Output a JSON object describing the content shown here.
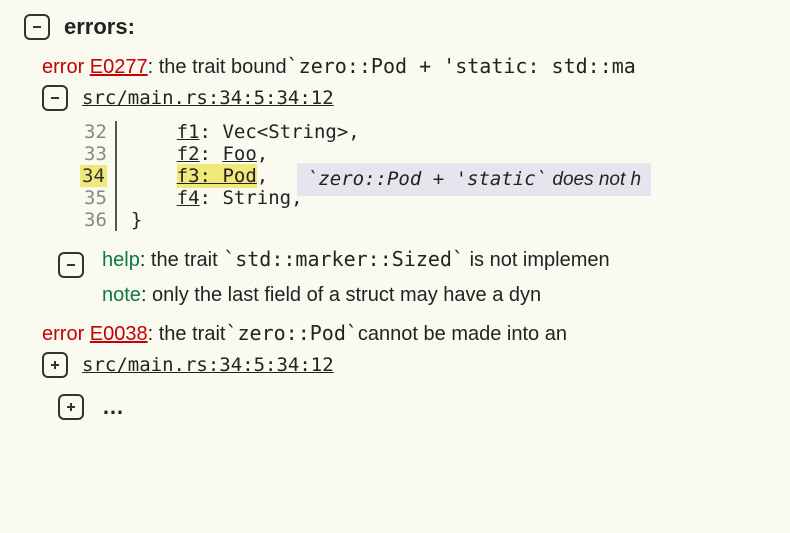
{
  "header": "errors:",
  "errors": [
    {
      "label": "error",
      "code": "E0277",
      "msg_pre": ": the trait bound ",
      "msg_code": "`zero::Pod + 'static: std::ma",
      "loc": "src/main.rs:34:5:34:12",
      "snippet": {
        "lines": [
          {
            "n": "32",
            "pre": "    ",
            "field": "f1",
            "sep": ": ",
            "ty": "Vec<String>,",
            "hl": false
          },
          {
            "n": "33",
            "pre": "    ",
            "field": "f2",
            "sep": ": ",
            "ty": "Foo",
            "tail": ",",
            "hl": false,
            "ul_ty": true
          },
          {
            "n": "34",
            "pre": "    ",
            "field": "f3",
            "sep": ": ",
            "ty": "Pod",
            "tail": ",",
            "hl": true
          },
          {
            "n": "35",
            "pre": "    ",
            "field": "f4",
            "sep": ": ",
            "ty": "String,",
            "hl": false
          },
          {
            "n": "36",
            "pre": "}",
            "field": "",
            "sep": "",
            "ty": "",
            "hl": false
          }
        ]
      },
      "tooltip_code": "`zero::Pod + 'static`",
      "tooltip_rest": " does not h",
      "help_label": "help",
      "help_pre": ": the trait ",
      "help_code": "`std::marker::Sized`",
      "help_post": " is not implemen",
      "note_label": "note",
      "note_text": ": only the last field of a struct may have a dyn"
    },
    {
      "label": "error",
      "code": "E0038",
      "msg_pre": ": the trait ",
      "msg_code": "`zero::Pod`",
      "msg_post": " cannot be made into an",
      "loc": "src/main.rs:34:5:34:12"
    }
  ],
  "ellipsis": "…"
}
